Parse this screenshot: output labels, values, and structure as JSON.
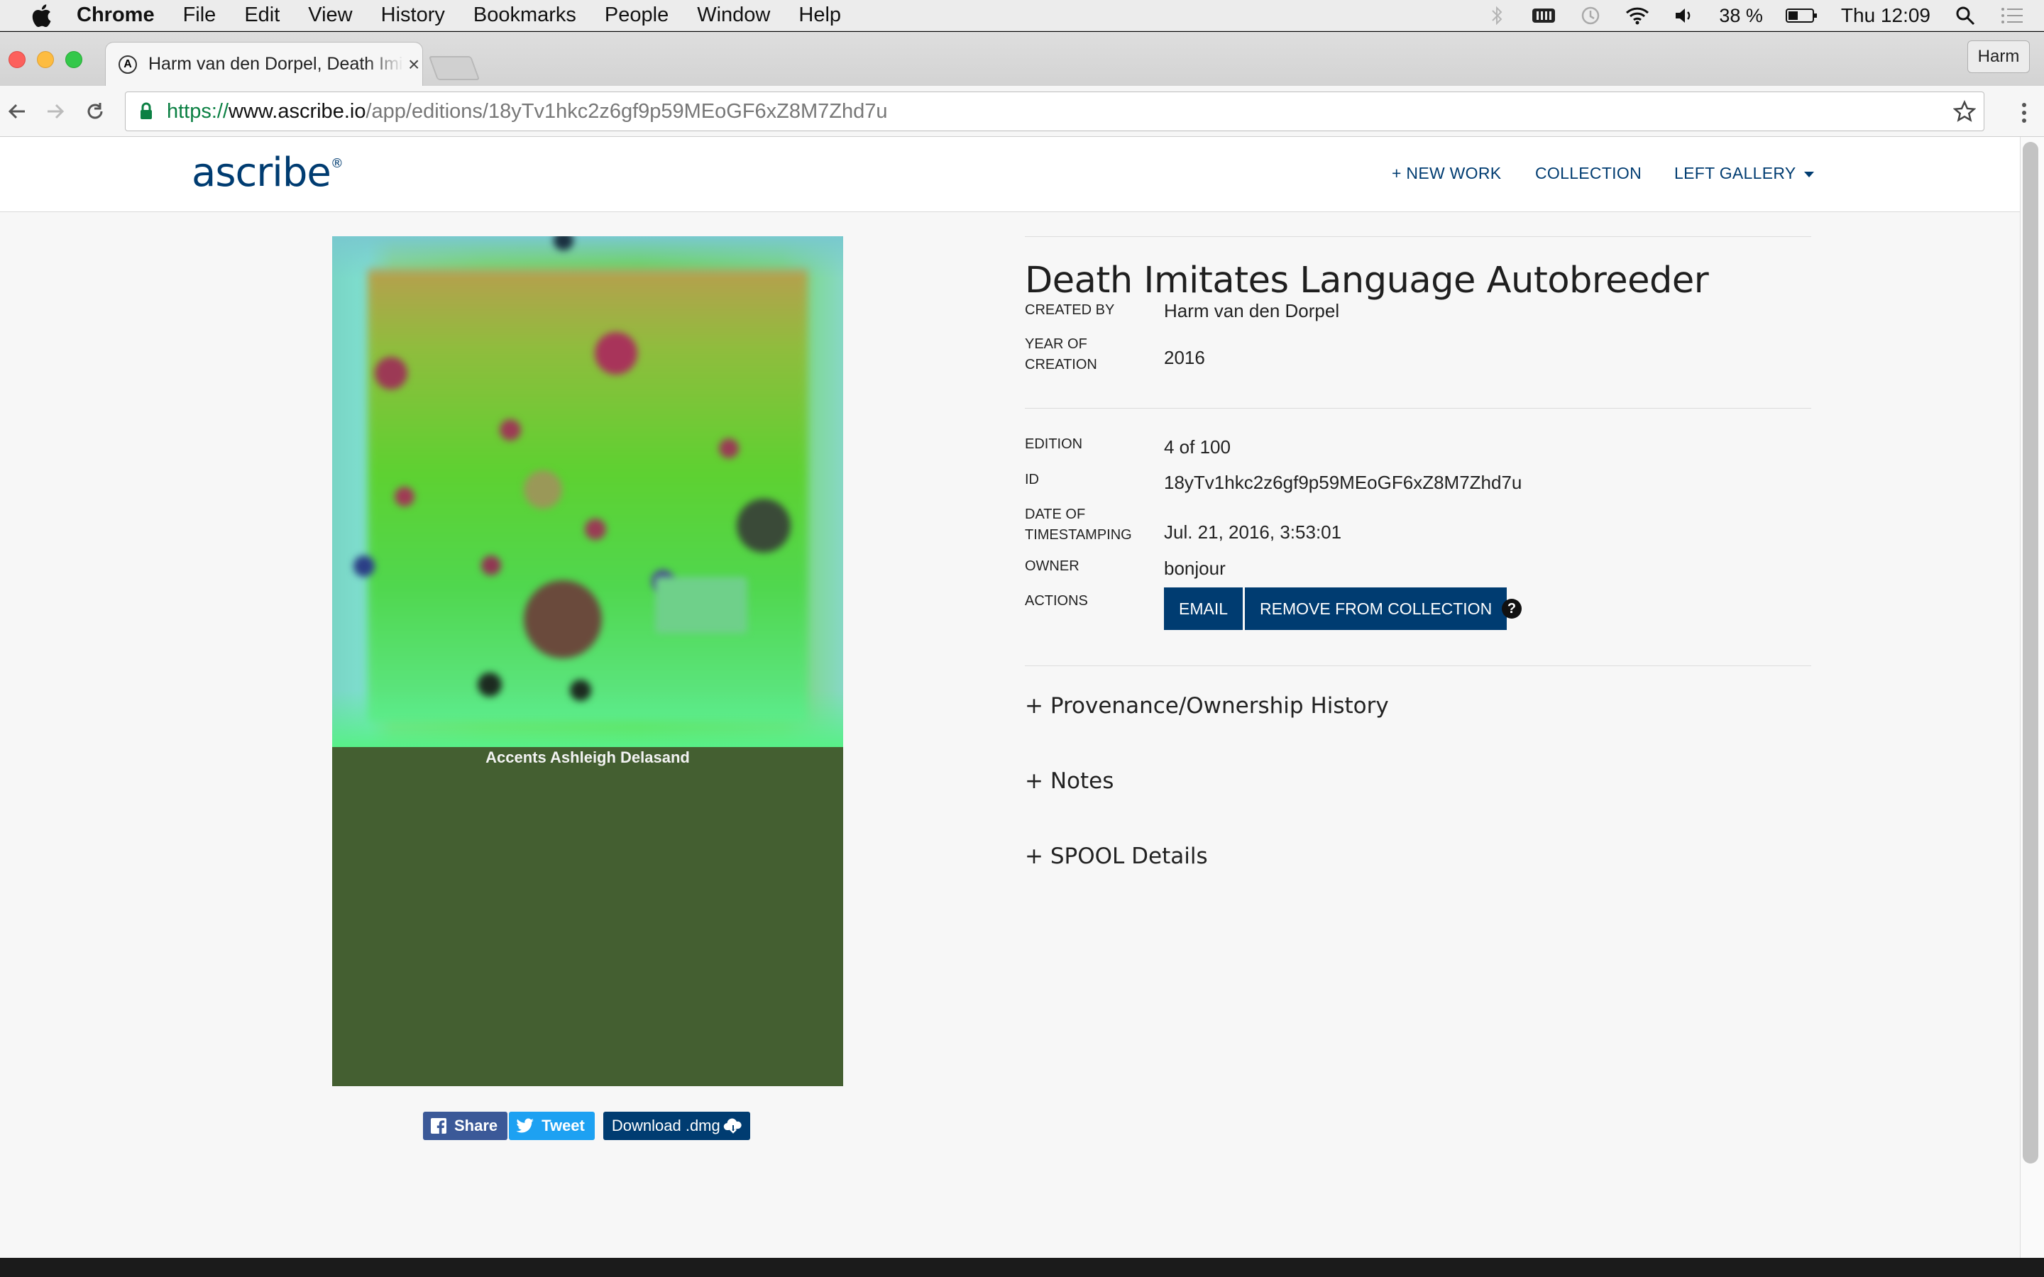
{
  "menubar": {
    "app": "Chrome",
    "items": [
      "File",
      "Edit",
      "View",
      "History",
      "Bookmarks",
      "People",
      "Window",
      "Help"
    ],
    "battery": "38 %",
    "clock": "Thu 12:09"
  },
  "browser": {
    "tab_title": "Harm van den Dorpel, Death Imitates Language Autobreeder",
    "profile": "Harm",
    "url_scheme": "https://",
    "url_host": "www.ascribe.io",
    "url_path": "/app/editions/18yTv1hkc2z6gf9p59MEoGF6xZ8M7Zhd7u"
  },
  "site": {
    "logo": "ascribe",
    "nav": {
      "new_work": "+ NEW WORK",
      "collection": "COLLECTION",
      "account": "LEFT GALLERY"
    }
  },
  "artwork": {
    "caption": "Accents Ashleigh Delasand",
    "share": "Share",
    "tweet": "Tweet",
    "download": "Download .dmg"
  },
  "details": {
    "title": "Death Imitates Language Autobreeder",
    "created_by_label": "CREATED BY",
    "created_by": "Harm van den Dorpel",
    "year_label_1": "YEAR OF",
    "year_label_2": "CREATION",
    "year": "2016",
    "edition_label": "EDITION",
    "edition": "4 of 100",
    "id_label": "ID",
    "id": "18yTv1hkc2z6gf9p59MEoGF6xZ8M7Zhd7u",
    "date_label_1": "DATE OF",
    "date_label_2": "TIMESTAMPING",
    "date": "Jul. 21, 2016, 3:53:01",
    "owner_label": "OWNER",
    "owner": "bonjour",
    "actions_label": "ACTIONS",
    "email_btn": "EMAIL",
    "remove_btn": "REMOVE FROM COLLECTION",
    "help_glyph": "?",
    "provenance": "+ Provenance/Ownership History",
    "notes": "+ Notes",
    "spool": "+ SPOOL Details"
  }
}
